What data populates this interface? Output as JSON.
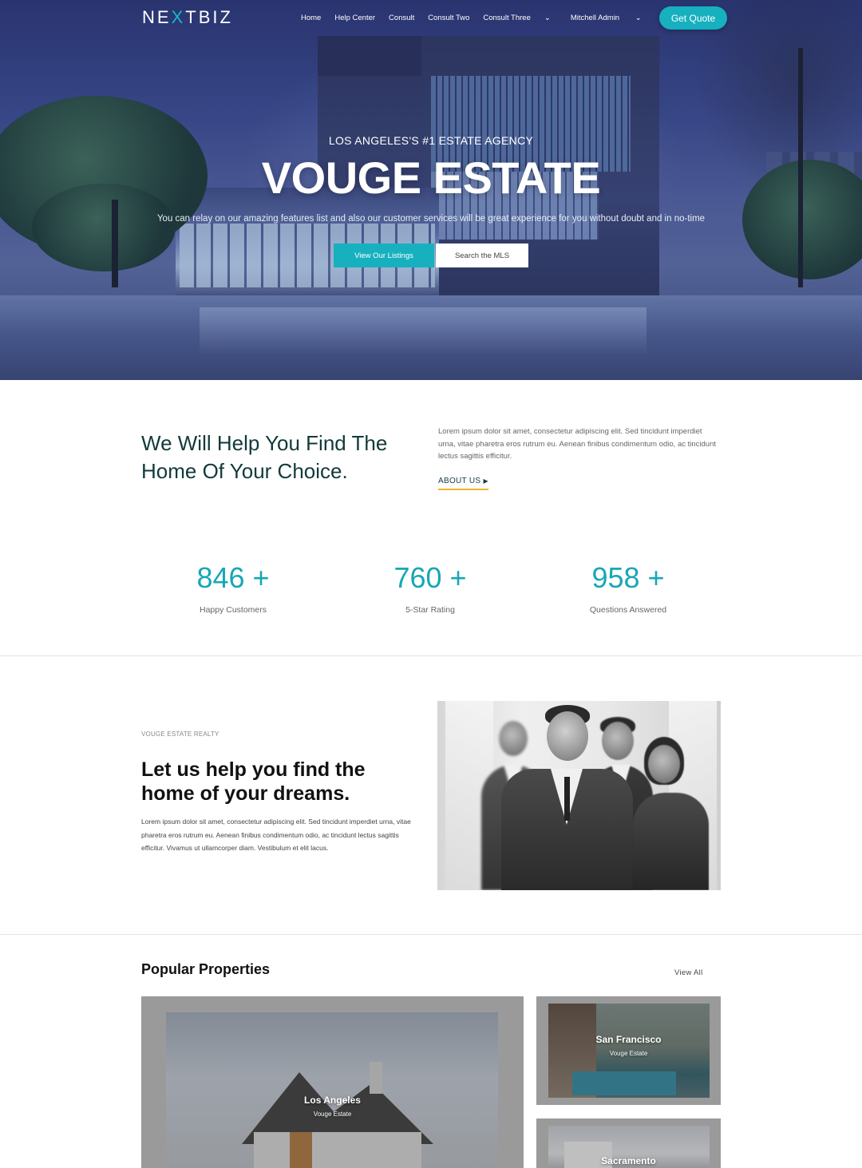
{
  "nav": {
    "logo_left": "NE",
    "logo_x": "X",
    "logo_right": "TBIZ",
    "links": [
      "Home",
      "Help Center",
      "Consult",
      "Consult Two",
      "Consult Three"
    ],
    "user": "Mitchell Admin",
    "cta": "Get Quote"
  },
  "hero": {
    "kicker": "LOS ANGELES'S #1 ESTATE AGENCY",
    "title": "VOUGE ESTATE",
    "subtitle": "You can relay on our amazing features list and also our customer services will be great experience for you without doubt and in no-time",
    "primary_button": "View Our Listings",
    "secondary_button": "Search the MLS"
  },
  "about": {
    "heading": "We Will Help You Find The Home Of Your Choice.",
    "text": "Lorem ipsum dolor sit amet, consectetur adipiscing elit. Sed tincidunt imperdiet urna, vitae pharetra eros rutrum eu. Aenean finibus condimentum odio, ac tincidunt lectus sagittis efficitur.",
    "link": "ABOUT US"
  },
  "stats": [
    {
      "value": "846 +",
      "label": "Happy Customers"
    },
    {
      "value": "760 +",
      "label": "5-Star Rating"
    },
    {
      "value": "958 +",
      "label": "Questions Answered"
    }
  ],
  "realty": {
    "kicker": "VOUGE ESTATE REALTY",
    "heading": "Let us help you find the home of your dreams.",
    "text": "Lorem ipsum dolor sit amet, consectetur adipiscing elit. Sed tincidunt imperdiet urna, vitae pharetra eros rutrum eu. Aenean finibus condimentum odio, ac tincidunt lectus sagittis efficitur. Vivamus ut ullamcorper diam. Vestibulum et elit lacus."
  },
  "properties": {
    "title": "Popular Properties",
    "view_all": "View All",
    "cards": [
      {
        "city": "Los Angeles",
        "agency": "Vouge Estate"
      },
      {
        "city": "San Francisco",
        "agency": "Vouge Estate"
      },
      {
        "city": "Sacramento",
        "agency": ""
      }
    ]
  },
  "colors": {
    "accent": "#17b0bf",
    "heading_dark": "#123a3a",
    "underline": "#f0b429"
  }
}
